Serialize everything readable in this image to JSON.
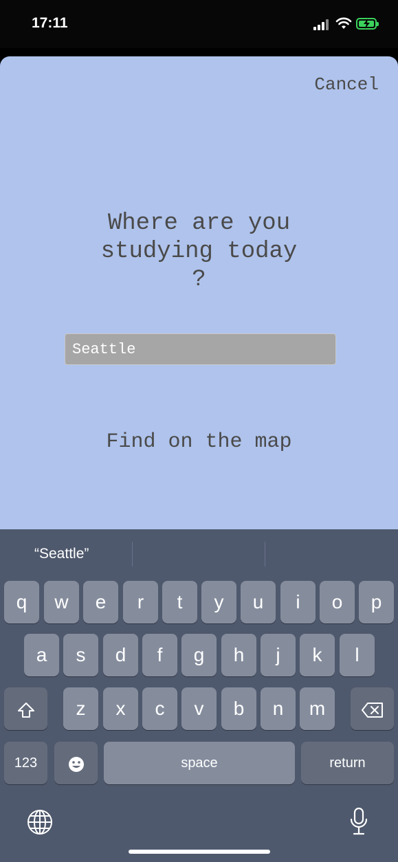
{
  "status_bar": {
    "time": "17:11",
    "signal_icon": "cellular-signal-icon",
    "wifi_icon": "wifi-icon",
    "battery_icon": "battery-charging-icon",
    "battery_color": "#3bd35d"
  },
  "sheet": {
    "background": "#afc3ec",
    "cancel_label": "Cancel",
    "question_lines": [
      "Where are you",
      "studying today",
      "?"
    ],
    "location_value": "Seattle",
    "find_on_map_label": "Find on the map"
  },
  "keyboard": {
    "suggestions": [
      "“Seattle”",
      "",
      ""
    ],
    "row1": [
      "q",
      "w",
      "e",
      "r",
      "t",
      "y",
      "u",
      "i",
      "o",
      "p"
    ],
    "row2": [
      "a",
      "s",
      "d",
      "f",
      "g",
      "h",
      "j",
      "k",
      "l"
    ],
    "row3": [
      "z",
      "x",
      "c",
      "v",
      "b",
      "n",
      "m"
    ],
    "numbers_label": "123",
    "space_label": "space",
    "return_label": "return",
    "shift_icon": "shift-icon",
    "delete_icon": "delete-backspace-icon",
    "emoji_icon": "emoji-icon",
    "globe_icon": "globe-icon",
    "mic_icon": "microphone-icon"
  }
}
